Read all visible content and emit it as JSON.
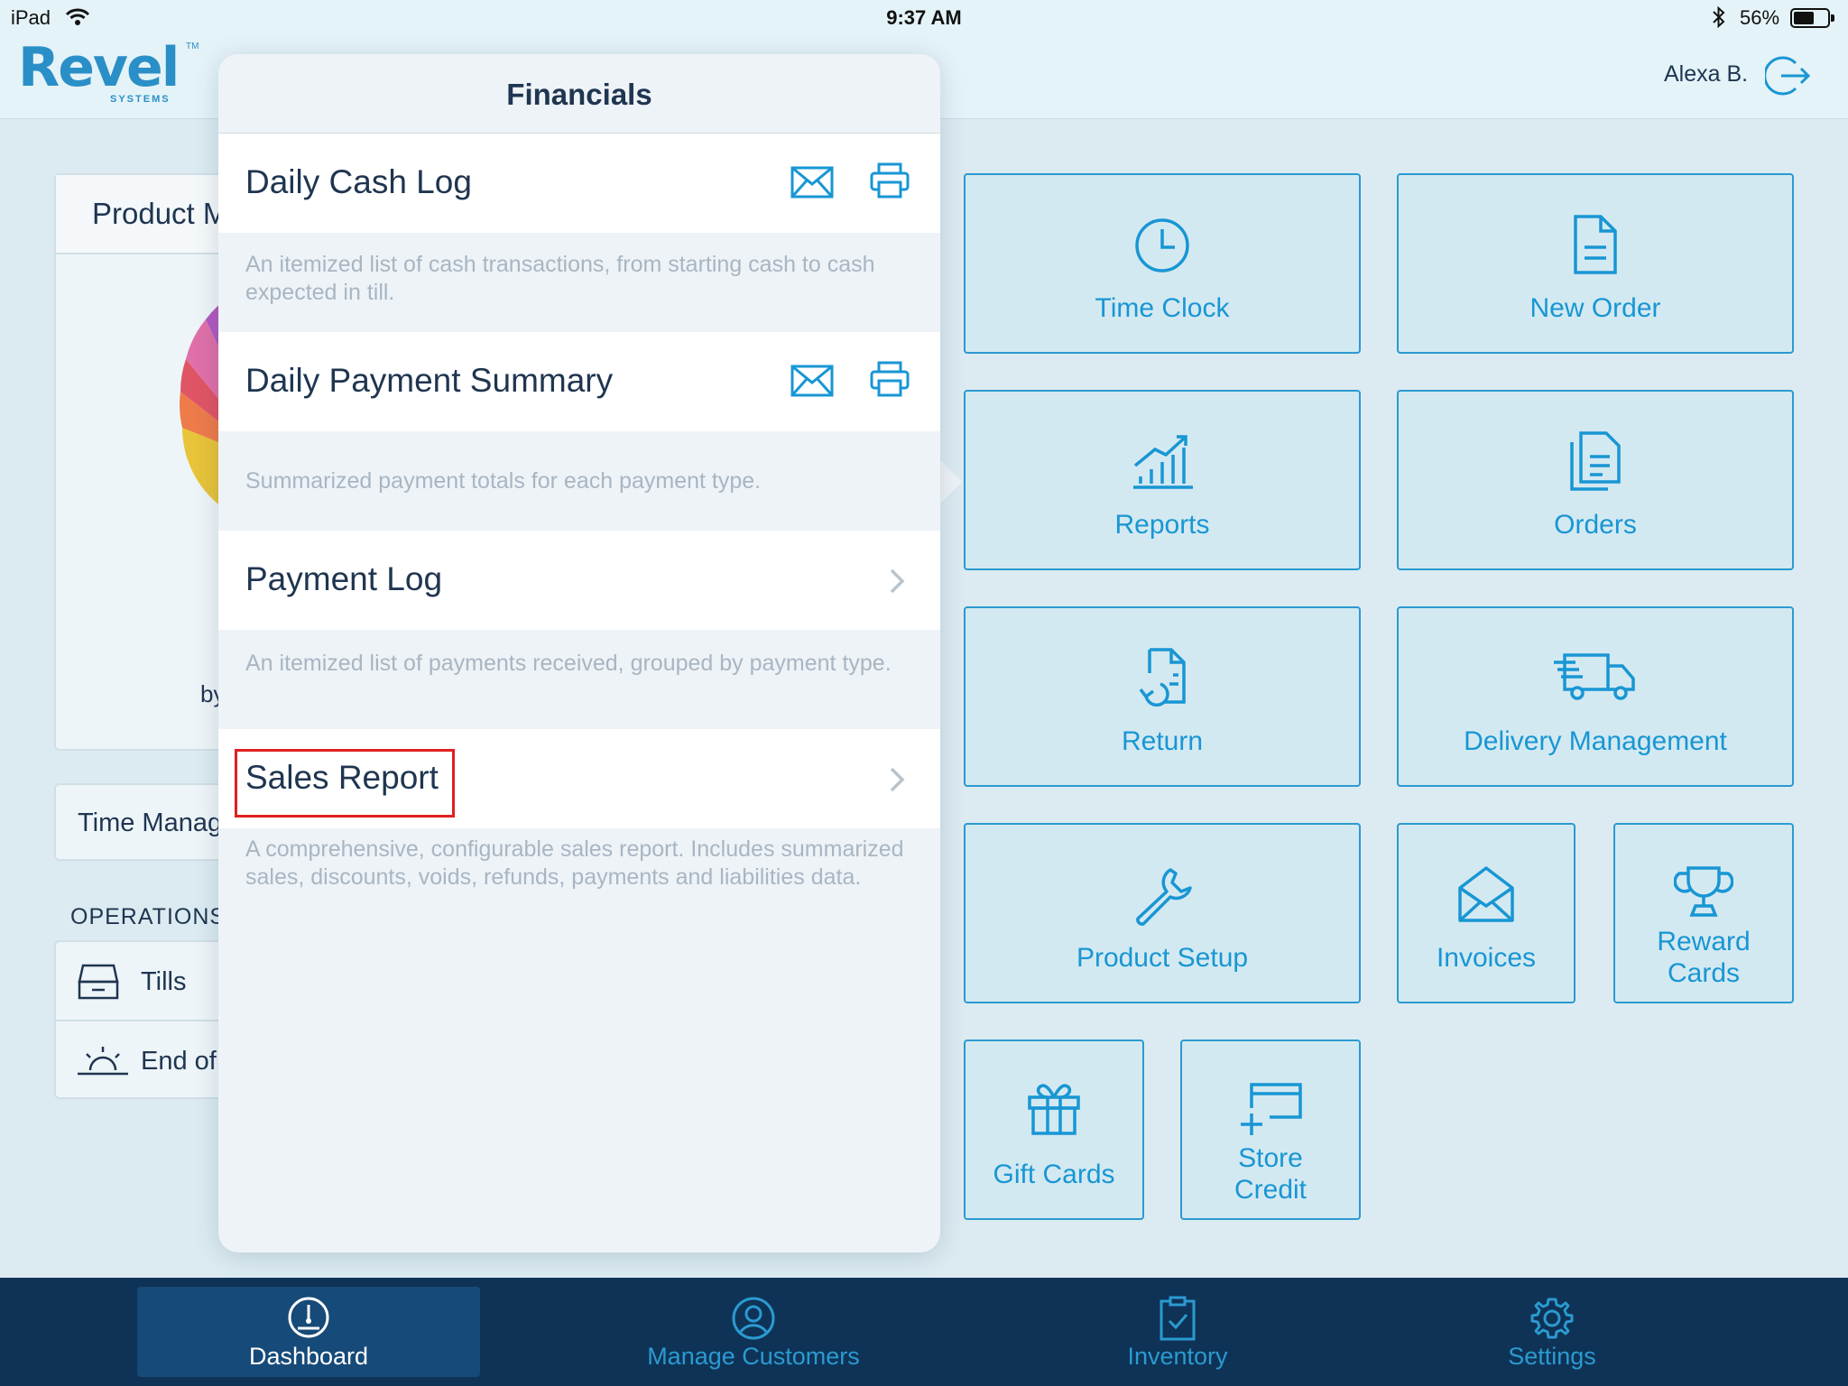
{
  "status_bar": {
    "carrier": "iPad",
    "time": "9:37 AM",
    "battery": "56%",
    "battery_level": 0.56
  },
  "header": {
    "logo_text": "Revel",
    "logo_sub": "SYSTEMS",
    "logo_tm": "TM",
    "user": "Alexa B."
  },
  "background_panels": {
    "product_card_title": "Product M",
    "product_card_by": "by",
    "time_card_title": "Time Manag",
    "operations_label": "OPERATIONS",
    "ops_items": [
      "Tills",
      "End of"
    ]
  },
  "popover": {
    "title": "Financials",
    "items": [
      {
        "title": "Daily Cash Log",
        "description": "An itemized list of cash transactions, from starting cash to cash expected in till."
      },
      {
        "title": "Daily Payment Summary",
        "description": "Summarized payment totals for each payment type."
      },
      {
        "title": "Payment Log",
        "description": "An itemized list of payments received, grouped by payment type."
      },
      {
        "title": "Sales Report",
        "description": "A comprehensive, configurable sales report. Includes summarized sales, discounts, voids, refunds, payments and liabilities data."
      }
    ]
  },
  "tiles": {
    "time_clock": "Time Clock",
    "new_order": "New Order",
    "reports": "Reports",
    "orders": "Orders",
    "return": "Return",
    "delivery_management": "Delivery Management",
    "product_setup": "Product Setup",
    "invoices": "Invoices",
    "reward_cards_1": "Reward",
    "reward_cards_2": "Cards",
    "gift_cards": "Gift Cards",
    "store_credit_1": "Store",
    "store_credit_2": "Credit"
  },
  "tabbar": {
    "dashboard": "Dashboard",
    "manage_customers": "Manage Customers",
    "inventory": "Inventory",
    "settings": "Settings",
    "active": "Dashboard"
  },
  "colors": {
    "accent": "#1896d4",
    "tile_bg": "#d3e9f1",
    "tabbar_bg": "#0e3356",
    "tab_active_bg": "#164a78",
    "highlight": "#e02020"
  }
}
